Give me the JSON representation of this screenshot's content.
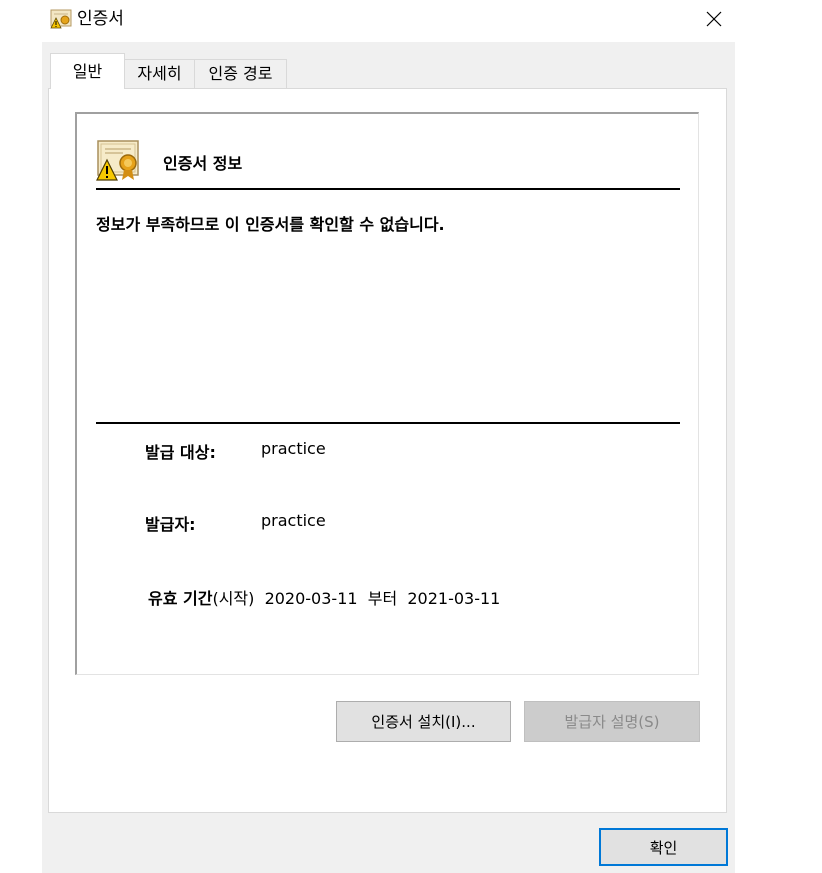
{
  "window": {
    "title": "인증서",
    "close_glyph": "✕"
  },
  "tabs": [
    {
      "label": "일반",
      "active": true
    },
    {
      "label": "자세히",
      "active": false
    },
    {
      "label": "인증 경로",
      "active": false
    }
  ],
  "info": {
    "header": "인증서 정보",
    "icon": "certificate-warning-icon",
    "status_message": "정보가 부족하므로 이 인증서를 확인할 수 없습니다.",
    "issued_to_label": "발급 대상:",
    "issued_to_value": "practice",
    "issued_by_label": "발급자:",
    "issued_by_value": "practice",
    "validity_label": "유효 기간",
    "validity_from_label": "(시작)",
    "valid_from": "2020-03-11",
    "validity_to_label": "부터",
    "valid_to": "2021-03-11"
  },
  "buttons": {
    "install": "인증서 설치(I)...",
    "issuer_statement": "발급자 설명(S)",
    "ok": "확인"
  },
  "colors": {
    "dialog_bg": "#f0f0f0",
    "focus_border": "#0078d7",
    "disabled_text": "#8a8a8a"
  }
}
